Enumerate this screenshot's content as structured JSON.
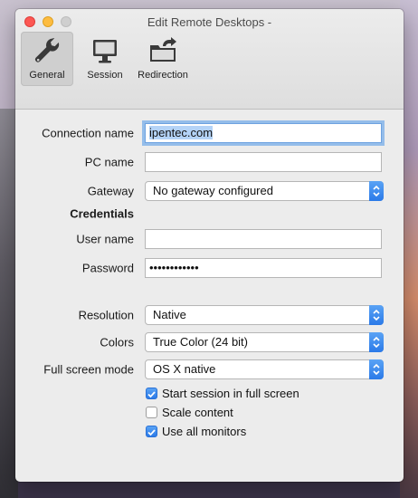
{
  "window": {
    "title": "Edit Remote Desktops -"
  },
  "toolbar": {
    "items": [
      {
        "label": "General"
      },
      {
        "label": "Session"
      },
      {
        "label": "Redirection"
      }
    ]
  },
  "form": {
    "connection_name": {
      "label": "Connection name",
      "value": "ipentec.com"
    },
    "pc_name": {
      "label": "PC name",
      "value": ""
    },
    "gateway": {
      "label": "Gateway",
      "value": "No gateway configured"
    },
    "credentials_heading": "Credentials",
    "user_name": {
      "label": "User name",
      "value": ""
    },
    "password": {
      "label": "Password",
      "value": "••••••••••••"
    },
    "resolution": {
      "label": "Resolution",
      "value": "Native"
    },
    "colors": {
      "label": "Colors",
      "value": "True Color (24 bit)"
    },
    "full_screen_mode": {
      "label": "Full screen mode",
      "value": "OS X native"
    },
    "checkboxes": [
      {
        "label": "Start session in full screen",
        "checked": true
      },
      {
        "label": "Scale content",
        "checked": false
      },
      {
        "label": "Use all monitors",
        "checked": true
      }
    ]
  },
  "colors": {
    "accent": "#2b7ae8",
    "close": "#fc5753",
    "minimize": "#fdbc40",
    "focus_ring": "#94bdea"
  }
}
